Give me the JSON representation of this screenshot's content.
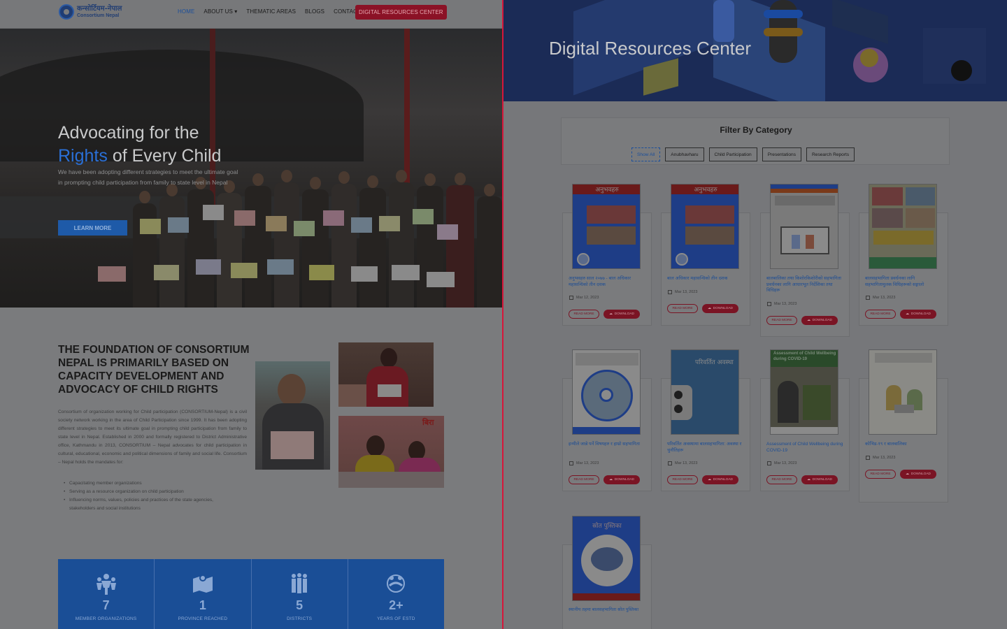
{
  "nav": {
    "logo_line1": "कन्सोर्टियम-नेपाल",
    "logo_line2": "Consortium Nepal",
    "home": "HOME",
    "about": "ABOUT US",
    "thematic": "THEMATIC AREAS",
    "blogs": "BLOGS",
    "contact": "CONTACT",
    "drc": "DIGITAL RESOURCES CENTER"
  },
  "hero": {
    "title_line1": "Advocating for the",
    "title_accent": "Rights",
    "title_line2_rest": " of Every Child",
    "subtitle": "We have been adopting different strategies to meet the ultimate goal in prompting child participation from family to state level in Nepal",
    "cta": "LEARN MORE"
  },
  "foundation": {
    "title": "The foundation of Consortium Nepal is primarily based on Capacity Development and Advocacy of Child Rights",
    "body": "Consortium of organization working for Child participation (CONSORTIUM-Nepal) is a civil society network working in the area of Child Participation since 1999. It has been adopting different strategies to meet its ultimate goal in prompting child participation from family to state level in Nepal. Established in 2000 and formally registered to District Administrative office, Kathmandu in 2013, CONSORTIUM – Nepal advocates for child participation in cultural, educational, economic and political dimensions of family and social life. Consortium – Nepal holds the mandates for:",
    "list": [
      "Capacitating member organizations",
      "Serving as a resource organization on child participation",
      "Influencing norms, values, policies and practices of the state agencies, stakeholders and social institutions"
    ]
  },
  "stats": [
    {
      "num": "7",
      "label": "MEMBER ORGANIZATIONS",
      "icon": "people-icon"
    },
    {
      "num": "1",
      "label": "PROVINCE REACHED",
      "icon": "map-icon"
    },
    {
      "num": "5",
      "label": "DISTRICTS",
      "icon": "group-icon"
    },
    {
      "num": "2+",
      "label": "YEARS OF ESTD",
      "icon": "hands-icon"
    }
  ],
  "resources": {
    "banner_title": "Digital Resources Center",
    "filter_title": "Filter By Category",
    "filters": [
      "Show All",
      "Anubhavharu",
      "Child Participation",
      "Presentations",
      "Research Reports"
    ],
    "read_more": "READ MORE",
    "download": "DOWNLOAD",
    "items": [
      {
        "title": "अनुभवहरु साल २०७७ - बाल अधिकार महासन्धिको तीन दशक",
        "date": "Mar 12, 2023",
        "cover": "अनुभवहरु"
      },
      {
        "title": "बाल अधिकार महासन्धिको तीन दशक",
        "date": "Mar 13, 2023",
        "cover": "अनुभवहरु"
      },
      {
        "title": "बालबालिका तथा किशोरकिशोरीको सहभागिता प्रवर्धनका लागि आधारभूत निर्देशिका तथा विधिहरू",
        "date": "Mar 13, 2023",
        "cover": ""
      },
      {
        "title": "बालसहभागिता प्रवर्धनका लागि सहभागितामुलक विधिहरूको सङ्गालो",
        "date": "Mar 13, 2023",
        "cover": ""
      },
      {
        "title": "इन्मीले जान्ने पर्ने विषयहरु र हाम्रो सहभागिता",
        "date": "Mar 13, 2023",
        "cover": ""
      },
      {
        "title": "परिवर्तित अवस्थामा बालसहभागिता: अवस्था र चुनौतिहरू",
        "date": "Mar 13, 2023",
        "cover": "परिवर्तित अवस्था"
      },
      {
        "title": "Assessment of Child Wellbeing during COVID-19",
        "date": "Mar 13, 2023",
        "cover": "Assessment of Child Wellbeing during COVID-19"
      },
      {
        "title": "कोभिड-१९ र बालबालिका",
        "date": "Mar 13, 2023",
        "cover": ""
      },
      {
        "title": "स्थानीय तहमा बालसहभागिता स्रोत पुस्तिका",
        "date": "",
        "cover": "स्रोत पुस्तिका"
      }
    ]
  }
}
